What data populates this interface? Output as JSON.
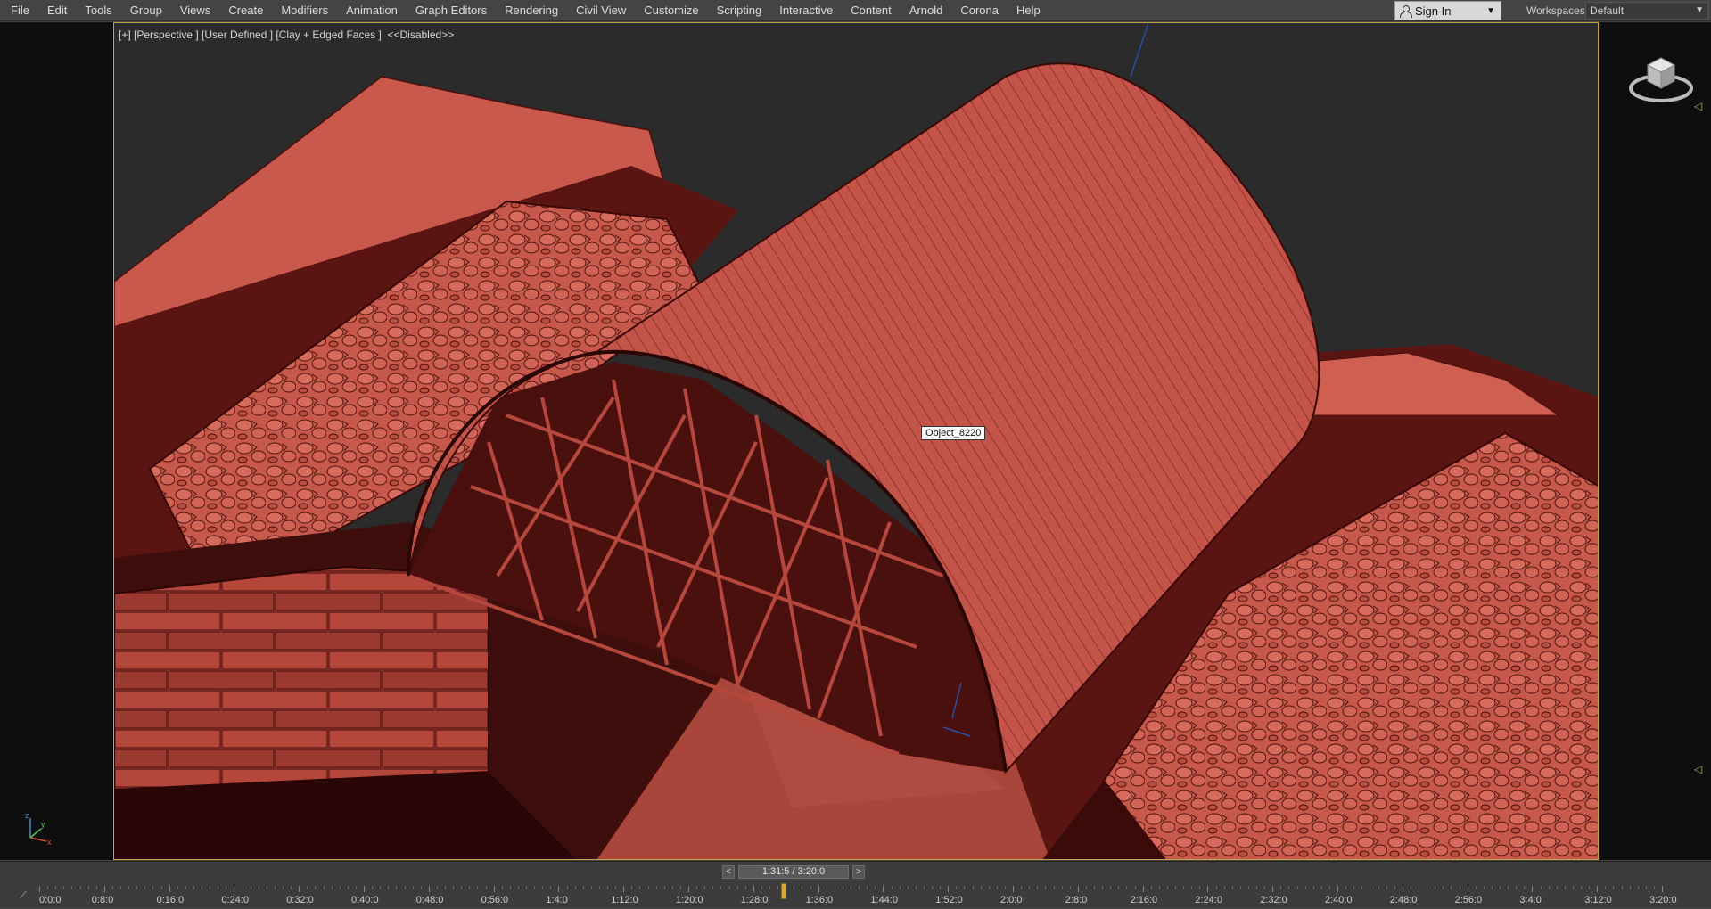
{
  "menubar": {
    "items": [
      "File",
      "Edit",
      "Tools",
      "Group",
      "Views",
      "Create",
      "Modifiers",
      "Animation",
      "Graph Editors",
      "Rendering",
      "Civil View",
      "Customize",
      "Scripting",
      "Interactive",
      "Content",
      "Arnold",
      "Corona",
      "Help"
    ],
    "signin_label": "Sign In",
    "workspaces_label": "Workspaces:",
    "workspace_value": "Default"
  },
  "viewport": {
    "label": "[+] [Perspective ] [User Defined ] [Clay + Edged Faces ]  <<Disabled>>",
    "tooltip": "Object_8220",
    "colors": {
      "clay": "#c9584a",
      "clay_dark": "#5a1411",
      "clay_mid": "#9b3a31",
      "background": "#2a2a2a",
      "frame": "#c9a54a"
    }
  },
  "axis": {
    "y": "y",
    "x": "x",
    "z": "z"
  },
  "timeline": {
    "slider_prev": "<",
    "slider_next": ">",
    "slider_value": "1:31:5 / 3:20:0",
    "ticks": [
      "0:0:0",
      "0:8:0",
      "0:16:0",
      "0:24:0",
      "0:32:0",
      "0:40:0",
      "0:48:0",
      "0:56:0",
      "1:4:0",
      "1:12:0",
      "1:20:0",
      "1:28:0",
      "1:36:0",
      "1:44:0",
      "1:52:0",
      "2:0:0",
      "2:8:0",
      "2:16:0",
      "2:24:0",
      "2:32:0",
      "2:40:0",
      "2:48:0",
      "2:56:0",
      "3:4:0",
      "3:12:0",
      "3:20:0"
    ],
    "playhead_progress": 0.457
  }
}
